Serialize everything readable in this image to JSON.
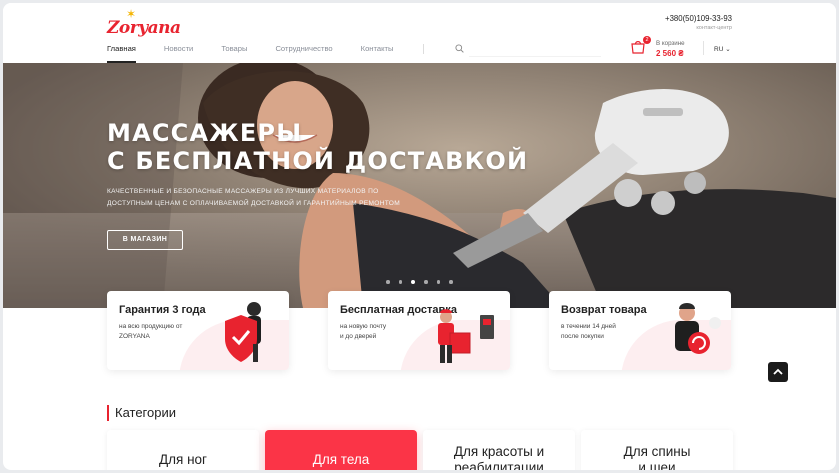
{
  "header": {
    "logo": "Zoryana",
    "phone": "+380(50)109-33-93",
    "phone_sub": "контакт-центр",
    "nav": [
      "Главная",
      "Новости",
      "Товары",
      "Сотрудничество",
      "Контакты"
    ],
    "search": {
      "placeholder": "",
      "value": ""
    },
    "cart": {
      "count": "2",
      "label": "В корзине",
      "total": "2 560 ₴"
    },
    "lang": "RU"
  },
  "hero": {
    "title_line1": "МАССАЖЕРЫ",
    "title_line2": "С БЕСПЛАТНОЙ ДОСТАВКОЙ",
    "sub_line1": "КАЧЕСТВЕННЫЕ И БЕЗОПАСНЫЕ МАССАЖЕРЫ ИЗ ЛУЧШИХ МАТЕРИАЛОВ ПО",
    "sub_line2": "ДОСТУПНЫМ ЦЕНАМ С ОПЛАЧИВАЕМОЙ ДОСТАВКОЙ И ГАРАНТИЙНЫМ РЕМОНТОМ",
    "button": "В МАГАЗИН",
    "slides": 6,
    "active_slide": 3
  },
  "features": [
    {
      "title": "Гарантия 3 года",
      "desc1": "на всю продукцию от",
      "desc2": "ZORYANA"
    },
    {
      "title": "Бесплатная доставка",
      "desc1": "на новую почту",
      "desc2": "и до дверей"
    },
    {
      "title": "Возврат товара",
      "desc1": "в течении 14 дней",
      "desc2": "после покупки"
    }
  ],
  "categories": {
    "heading": "Категории",
    "items": [
      {
        "line1": "Для ног",
        "line2": ""
      },
      {
        "line1": "Для тела",
        "line2": ""
      },
      {
        "line1": "Для красоты и",
        "line2": "реабилитации"
      },
      {
        "line1": "Для спины",
        "line2": "и шеи"
      }
    ]
  },
  "colors": {
    "accent": "#e8232f",
    "category_active": "#fb3447"
  }
}
